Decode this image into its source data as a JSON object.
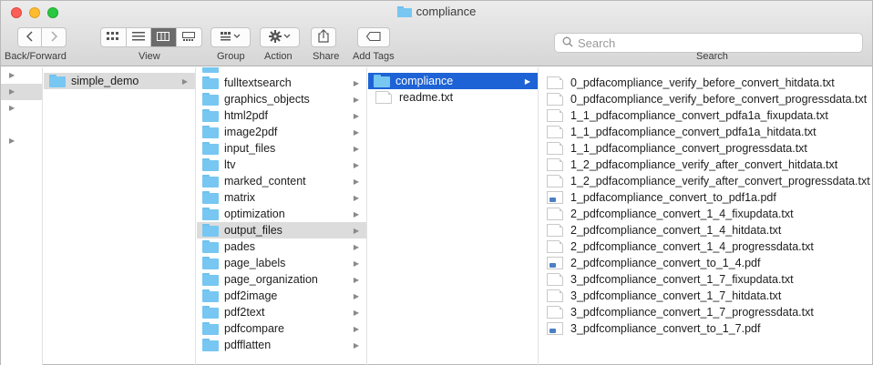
{
  "window": {
    "title": "compliance"
  },
  "toolbar": {
    "labels": {
      "back_forward": "Back/Forward",
      "view": "View",
      "group": "Group",
      "action": "Action",
      "share": "Share",
      "add_tags": "Add Tags",
      "search": "Search"
    },
    "search_placeholder": "Search"
  },
  "column1": {
    "items": [
      {
        "label": "simple_demo"
      }
    ]
  },
  "column2": {
    "items": [
      {
        "label": "fulltextsearch"
      },
      {
        "label": "graphics_objects"
      },
      {
        "label": "html2pdf"
      },
      {
        "label": "image2pdf"
      },
      {
        "label": "input_files"
      },
      {
        "label": "ltv"
      },
      {
        "label": "marked_content"
      },
      {
        "label": "matrix"
      },
      {
        "label": "optimization"
      },
      {
        "label": "output_files"
      },
      {
        "label": "pades"
      },
      {
        "label": "page_labels"
      },
      {
        "label": "page_organization"
      },
      {
        "label": "pdf2image"
      },
      {
        "label": "pdf2text"
      },
      {
        "label": "pdfcompare"
      },
      {
        "label": "pdfflatten"
      }
    ]
  },
  "column3": {
    "items": [
      {
        "label": "compliance"
      },
      {
        "label": "readme.txt"
      }
    ]
  },
  "column4": {
    "items": [
      {
        "label": "0_pdfacompliance_verify_before_convert_hitdata.txt"
      },
      {
        "label": "0_pdfacompliance_verify_before_convert_progressdata.txt"
      },
      {
        "label": "1_1_pdfacompliance_convert_pdfa1a_fixupdata.txt"
      },
      {
        "label": "1_1_pdfacompliance_convert_pdfa1a_hitdata.txt"
      },
      {
        "label": "1_1_pdfacompliance_convert_progressdata.txt"
      },
      {
        "label": "1_2_pdfacompliance_verify_after_convert_hitdata.txt"
      },
      {
        "label": "1_2_pdfacompliance_verify_after_convert_progressdata.txt"
      },
      {
        "label": "1_pdfacompliance_convert_to_pdf1a.pdf"
      },
      {
        "label": "2_pdfcompliance_convert_1_4_fixupdata.txt"
      },
      {
        "label": "2_pdfcompliance_convert_1_4_hitdata.txt"
      },
      {
        "label": "2_pdfcompliance_convert_1_4_progressdata.txt"
      },
      {
        "label": "2_pdfcompliance_convert_to_1_4.pdf"
      },
      {
        "label": "3_pdfcompliance_convert_1_7_fixupdata.txt"
      },
      {
        "label": "3_pdfcompliance_convert_1_7_hitdata.txt"
      },
      {
        "label": "3_pdfcompliance_convert_1_7_progressdata.txt"
      },
      {
        "label": "3_pdfcompliance_convert_to_1_7.pdf"
      }
    ]
  },
  "colors": {
    "selection_blue": "#1d63d6",
    "selection_grey": "#dcdcdc",
    "folder": "#77c7f2"
  }
}
